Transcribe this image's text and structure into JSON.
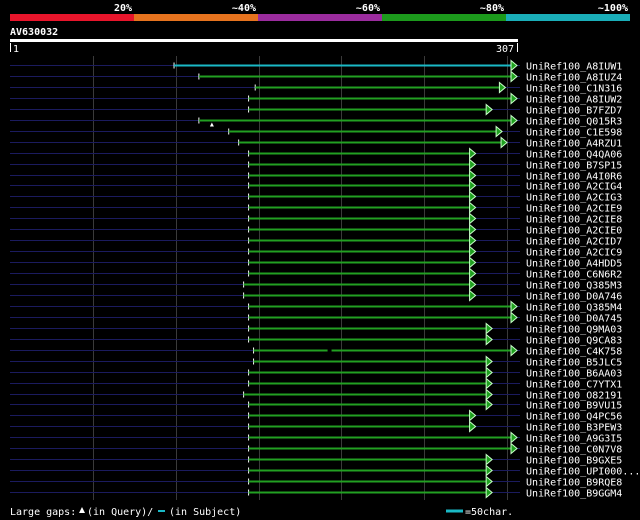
{
  "scale_bar": {
    "segments": [
      {
        "label": "20%",
        "color": "#e8152b"
      },
      {
        "label": "~40%",
        "color": "#e6731e"
      },
      {
        "label": "~60%",
        "color": "#9b2c9e"
      },
      {
        "label": "~80%",
        "color": "#1c9a1c"
      },
      {
        "label": "~100%",
        "color": "#1aaeb9"
      }
    ]
  },
  "query": {
    "name": "AV630032",
    "start_label": "1",
    "end_label": "307",
    "length": 307
  },
  "colors": {
    "hit_line": "#22a022",
    "hit_line_top": "#1ab9c6",
    "arrow_fill": "#1fa01f",
    "arrow_stroke": "#c8ffc8",
    "backbone": "#1b1b5e",
    "gridline": "#3a3a3a",
    "query_bar": "#ffffff",
    "ref_legend": "#1ab9c6"
  },
  "hits": [
    {
      "name": "UniRef100_A8IUW1",
      "start": 100,
      "end": 307,
      "top": true
    },
    {
      "name": "UniRef100_A8IUZ4",
      "start": 115,
      "end": 307
    },
    {
      "name": "UniRef100_C1N316",
      "start": 149,
      "end": 300
    },
    {
      "name": "UniRef100_A8IUW2",
      "start": 145,
      "end": 307
    },
    {
      "name": "UniRef100_B7FZD7",
      "start": 145,
      "end": 292
    },
    {
      "name": "UniRef100_Q015R3",
      "start": 115,
      "end": 307,
      "gap_query": true
    },
    {
      "name": "UniRef100_C1E598",
      "start": 133,
      "end": 298
    },
    {
      "name": "UniRef100_A4RZU1",
      "start": 139,
      "end": 301
    },
    {
      "name": "UniRef100_Q4QA06",
      "start": 145,
      "end": 282
    },
    {
      "name": "UniRef100_B7SP15",
      "start": 145,
      "end": 282
    },
    {
      "name": "UniRef100_A4I0R6",
      "start": 145,
      "end": 282
    },
    {
      "name": "UniRef100_A2CIG4",
      "start": 145,
      "end": 282
    },
    {
      "name": "UniRef100_A2CIG3",
      "start": 145,
      "end": 282
    },
    {
      "name": "UniRef100_A2CIE9",
      "start": 145,
      "end": 282
    },
    {
      "name": "UniRef100_A2CIE8",
      "start": 145,
      "end": 282
    },
    {
      "name": "UniRef100_A2CIE0",
      "start": 145,
      "end": 282
    },
    {
      "name": "UniRef100_A2CID7",
      "start": 145,
      "end": 282
    },
    {
      "name": "UniRef100_A2CIC9",
      "start": 145,
      "end": 282
    },
    {
      "name": "UniRef100_A4HDD5",
      "start": 145,
      "end": 282
    },
    {
      "name": "UniRef100_C6N6R2",
      "start": 145,
      "end": 282
    },
    {
      "name": "UniRef100_Q385M3",
      "start": 142,
      "end": 282
    },
    {
      "name": "UniRef100_D0A746",
      "start": 142,
      "end": 282
    },
    {
      "name": "UniRef100_Q385M4",
      "start": 145,
      "end": 307
    },
    {
      "name": "UniRef100_D0A745",
      "start": 145,
      "end": 307
    },
    {
      "name": "UniRef100_Q9MA03",
      "start": 145,
      "end": 292
    },
    {
      "name": "UniRef100_Q9CA83",
      "start": 145,
      "end": 292
    },
    {
      "name": "UniRef100_C4K758",
      "start": 148,
      "end": 307,
      "gap_subject": true
    },
    {
      "name": "UniRef100_B5JLC5",
      "start": 148,
      "end": 292
    },
    {
      "name": "UniRef100_B6AA03",
      "start": 145,
      "end": 292
    },
    {
      "name": "UniRef100_C7YTX1",
      "start": 145,
      "end": 292
    },
    {
      "name": "UniRef100_O82191",
      "start": 142,
      "end": 292
    },
    {
      "name": "UniRef100_B9VU15",
      "start": 145,
      "end": 292
    },
    {
      "name": "UniRef100_Q4PC56",
      "start": 145,
      "end": 282
    },
    {
      "name": "UniRef100_B3PEW3",
      "start": 145,
      "end": 282
    },
    {
      "name": "UniRef100_A9G3I5",
      "start": 145,
      "end": 307
    },
    {
      "name": "UniRef100_C0N7V8",
      "start": 145,
      "end": 307
    },
    {
      "name": "UniRef100_B9GXE5",
      "start": 145,
      "end": 292
    },
    {
      "name": "UniRef100_UPI000...",
      "start": 145,
      "end": 292
    },
    {
      "name": "UniRef100_B9RQE8",
      "start": 145,
      "end": 292
    },
    {
      "name": "UniRef100_B9GGM4",
      "start": 145,
      "end": 292
    }
  ],
  "footer": {
    "gaps_label": "Large gaps:",
    "query_gap_label": "(in Query)/",
    "subject_gap_label": "(in Subject)",
    "scale_label": "=50char."
  }
}
